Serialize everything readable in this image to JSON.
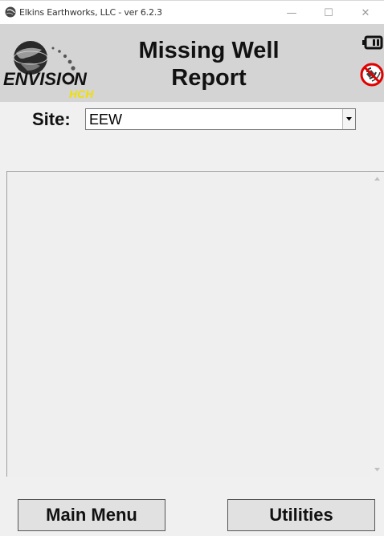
{
  "window": {
    "title": "Elkins Earthworks, LLC - ver 6.2.3",
    "minimize_glyph": "—",
    "maximize_glyph": "☐",
    "close_glyph": "✕"
  },
  "header": {
    "title_line1": "Missing Well",
    "title_line2": "Report",
    "logo_text": "ENVISION",
    "logo_subtext": "HCH",
    "status_icons": [
      "battery-icon",
      "no-signal-icon"
    ]
  },
  "site": {
    "label": "Site:",
    "value": "EEW"
  },
  "list": {
    "items": []
  },
  "footer": {
    "main_menu_label": "Main Menu",
    "utilities_label": "Utilities"
  },
  "colors": {
    "header_bg": "#d4d4d4",
    "body_bg": "#f0f0f0",
    "logo_yellow": "#f0e000",
    "no_signal_red": "#e00000"
  }
}
